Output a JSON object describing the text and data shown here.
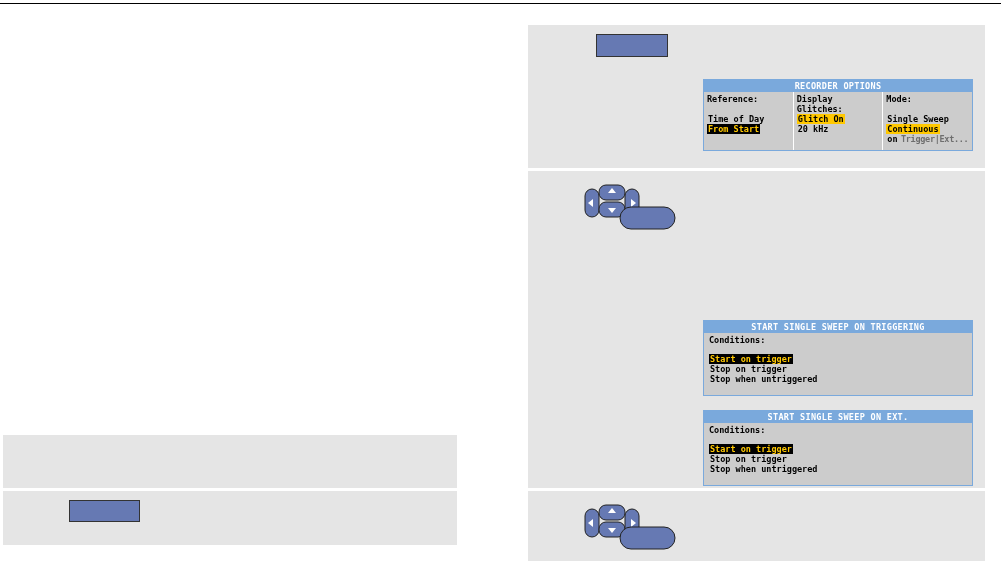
{
  "recorder_options": {
    "title": "RECORDER OPTIONS",
    "columns": [
      {
        "heading": "Reference:",
        "options": [
          {
            "text": "Time of Day",
            "selected": false,
            "cursor": false
          },
          {
            "text": "From Start",
            "selected": true,
            "cursor": true
          }
        ]
      },
      {
        "heading": "Display Glitches:",
        "options": [
          {
            "text": "Glitch On",
            "selected": true,
            "cursor": false
          },
          {
            "text": "20 kHz",
            "selected": false,
            "cursor": false
          }
        ]
      },
      {
        "heading": "Mode:",
        "options": [
          {
            "text": "Single Sweep",
            "selected": false,
            "cursor": false
          },
          {
            "text": "Continuous",
            "selected": true,
            "cursor": false
          },
          {
            "text": "on",
            "note": "Trigger|Ext...",
            "note_disabled": true,
            "selected": false,
            "cursor": false
          }
        ]
      }
    ]
  },
  "trigger_dialogs": [
    {
      "title": "START SINGLE SWEEP ON TRIGGERING",
      "heading": "Conditions:",
      "options": [
        {
          "text": "Start on trigger",
          "selected": true
        },
        {
          "text": "Stop on trigger",
          "selected": false
        },
        {
          "text": "Stop when untriggered",
          "selected": false
        }
      ]
    },
    {
      "title": "START SINGLE SWEEP ON EXT.",
      "heading": "Conditions:",
      "options": [
        {
          "text": "Start on trigger",
          "selected": true
        },
        {
          "text": "Stop on trigger",
          "selected": false
        },
        {
          "text": "Stop when untriggered",
          "selected": false
        }
      ]
    }
  ]
}
